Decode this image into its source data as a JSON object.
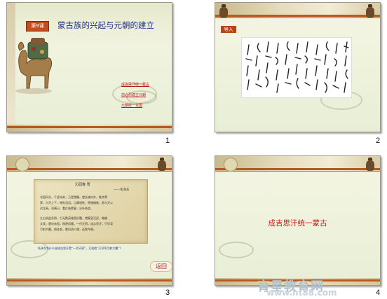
{
  "slides": [
    {
      "number": "1",
      "lesson_tag": "第9课",
      "title": "蒙古族的兴起与元朝的建立",
      "links": [
        "成吉思汗统一蒙古",
        "忽必烈建立元朝",
        "元朝统一全国"
      ]
    },
    {
      "number": "2",
      "intro_label": "导入"
    },
    {
      "number": "3",
      "poem_title": "沁园春 雪",
      "poem_author": "——毛泽东",
      "poem_lines": [
        "北国风光，千里冰封，万里雪飘。望长城内外，惟余莽",
        "莽；大河上下，顿失滔滔。山舞银蛇，原驰蜡象，欲与天公",
        "试比高。须晴日，看红装素裹，分外妖娆。",
        "江山如此多娇，引无数英雄竞折腰。惜秦皇汉武，略输",
        "文采；唐宗宋祖，稍逊风骚。一代天骄，成吉思汗，只识弯",
        "弓射大雕。俱往矣，数风流人物，还看今朝。"
      ],
      "note": "毛泽东为什么说成吉思汗是“一代天骄”，又说他“只识弯弓射大雕”？",
      "back_label": "返回"
    },
    {
      "number": "4",
      "heading": "成吉思汗统一蒙古"
    }
  ],
  "watermark": {
    "title": "育星教育网",
    "url": "www.ht88.com"
  },
  "colors": {
    "accent_red": "#c01818",
    "title_blue": "#1b2f8a",
    "band_orange": "#b65a23"
  }
}
